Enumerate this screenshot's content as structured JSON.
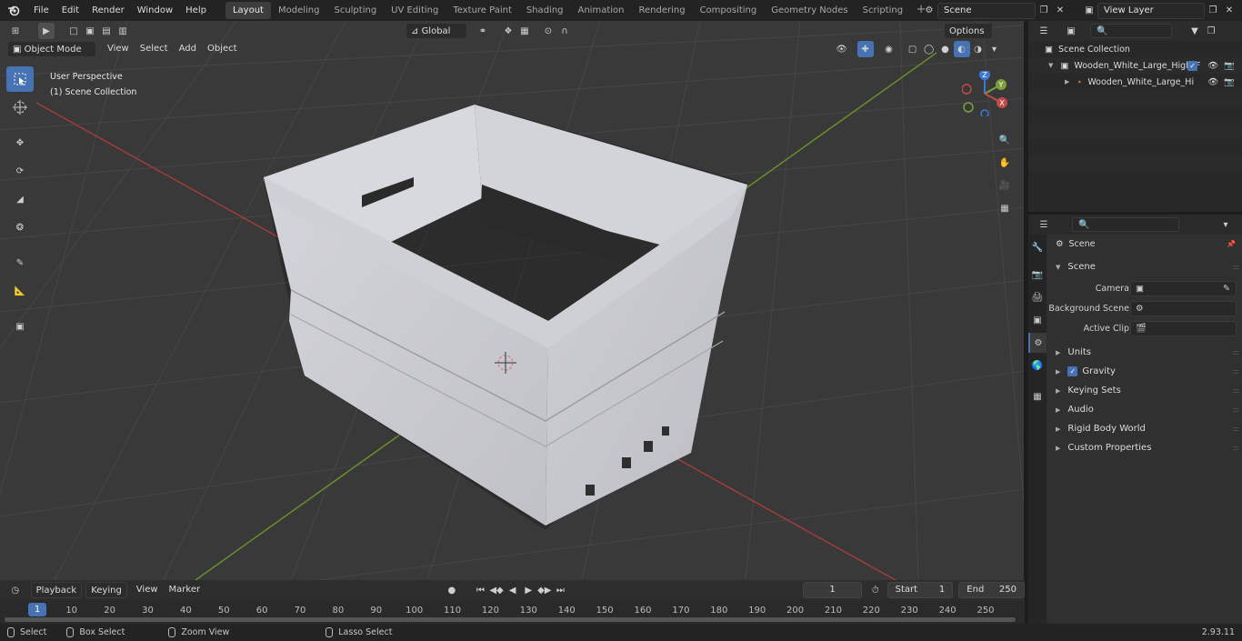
{
  "menubar": {
    "items": [
      "File",
      "Edit",
      "Render",
      "Window",
      "Help"
    ]
  },
  "workspaces": {
    "tabs": [
      "Layout",
      "Modeling",
      "Sculpting",
      "UV Editing",
      "Texture Paint",
      "Shading",
      "Animation",
      "Rendering",
      "Compositing",
      "Geometry Nodes",
      "Scripting"
    ],
    "active": "Layout",
    "add_label": "+"
  },
  "scene_selector": {
    "value": "Scene"
  },
  "view_layer_selector": {
    "value": "View Layer"
  },
  "viewport": {
    "mode": "Object Mode",
    "menus": [
      "View",
      "Select",
      "Add",
      "Object"
    ],
    "transform_orientation": "Global",
    "options_label": "Options",
    "info_line1": "User Perspective",
    "info_line2": "(1) Scene Collection",
    "gizmo": {
      "z": "Z",
      "y": "Y",
      "x": "X"
    }
  },
  "timeline": {
    "menus": [
      "Playback",
      "Keying",
      "View",
      "Marker"
    ],
    "current_frame": "1",
    "start_label": "Start",
    "start_value": "1",
    "end_label": "End",
    "end_value": "250",
    "ruler": [
      "1",
      "10",
      "20",
      "30",
      "40",
      "50",
      "60",
      "70",
      "80",
      "90",
      "100",
      "110",
      "120",
      "130",
      "140",
      "150",
      "160",
      "170",
      "180",
      "190",
      "200",
      "210",
      "220",
      "230",
      "240",
      "250"
    ]
  },
  "statusbar": {
    "select": "Select",
    "box_select": "Box Select",
    "zoom_view": "Zoom View",
    "lasso_select": "Lasso Select",
    "version": "2.93.11"
  },
  "outliner": {
    "root": "Scene Collection",
    "items": [
      {
        "label": "Wooden_White_Large_High_F",
        "type": "collection"
      },
      {
        "label": "Wooden_White_Large_Hi",
        "type": "object"
      }
    ]
  },
  "properties": {
    "context_title": "Scene",
    "scene_panel": "Scene",
    "camera_label": "Camera",
    "background_scene_label": "Background Scene",
    "active_clip_label": "Active Clip",
    "panels": [
      "Units",
      "Gravity",
      "Keying Sets",
      "Audio",
      "Rigid Body World",
      "Custom Properties"
    ]
  },
  "colors": {
    "accent": "#4772b3",
    "axis_x": "#c44a4a",
    "axis_y": "#7aa03a",
    "axis_z": "#3c7ad6"
  }
}
